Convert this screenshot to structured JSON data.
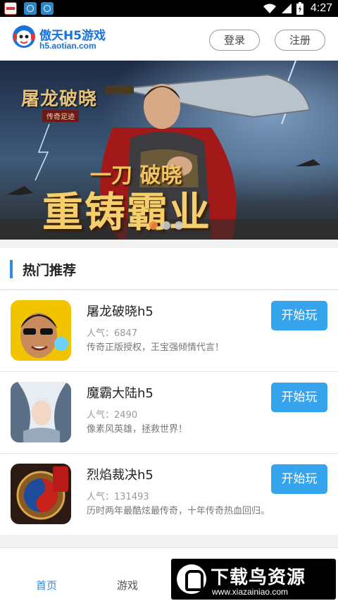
{
  "status_bar": {
    "time": "4:27",
    "icons": [
      "app-icon",
      "browser-icon",
      "browser-icon",
      "wifi-icon",
      "signal-icon",
      "battery-icon"
    ]
  },
  "header": {
    "site_name": "傲天H5游戏",
    "site_url": "h5.aotian.com",
    "login_label": "登录",
    "register_label": "注册"
  },
  "banner": {
    "game_title": "屠龙破晓",
    "game_sub": "传奇足迹",
    "slogan_line1": "一刀 破晓",
    "slogan_line2": "重铸霸业",
    "slide_count": 3,
    "active_slide": 1
  },
  "hot": {
    "section_title": "热门推荐",
    "popularity_prefix": "人气：",
    "play_label": "开始玩",
    "games": [
      {
        "name": "屠龙破晓h5",
        "popularity": "人气：6847",
        "desc": "传奇正版授权，王宝强倾情代言！",
        "icon": "game-icon-tulong"
      },
      {
        "name": "魔霸大陆h5",
        "popularity": "人气：2490",
        "desc": "像素风英雄，拯救世界！",
        "icon": "game-icon-moba"
      },
      {
        "name": "烈焰裁决h5",
        "popularity": "人气：131493",
        "desc": "历时两年最酷炫最传奇，十年传奇热血回归。",
        "icon": "game-icon-lieyan"
      }
    ]
  },
  "bottom_nav": {
    "home_label": "首页",
    "games_label": "游戏",
    "active": "首页"
  },
  "watermark": {
    "text": "下载鸟资源",
    "url": "www.xiazainiao.com"
  },
  "colors": {
    "accent": "#2d8ce8",
    "play_button": "#35a4ec",
    "brand_text": "#1a73d9"
  }
}
